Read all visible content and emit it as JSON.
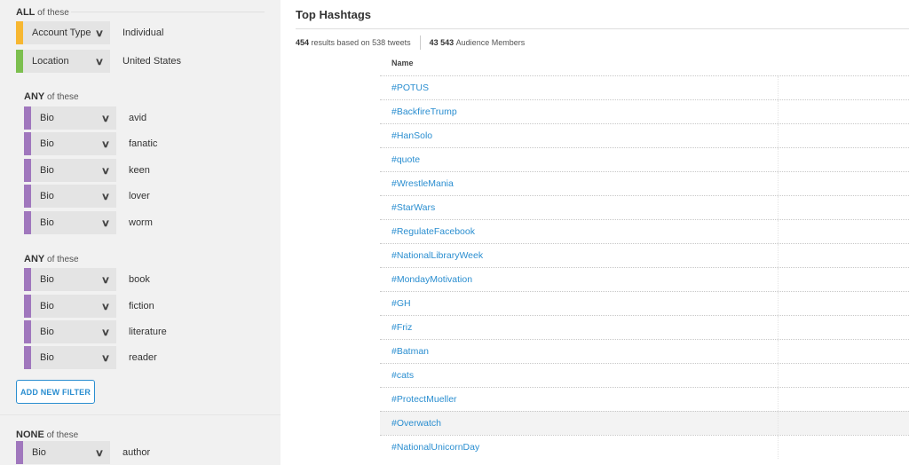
{
  "colors": {
    "yellow": "#f7b731",
    "green": "#7cbf4f",
    "purple": "#a077bd",
    "link": "#2a8ed0"
  },
  "sidebar": {
    "all_group": {
      "label_strong": "ALL",
      "label_rest": "of these",
      "filters": [
        {
          "field": "Account Type",
          "value": "Individual",
          "color": "yellow"
        },
        {
          "field": "Location",
          "value": "United States",
          "color": "green"
        }
      ]
    },
    "any_group_1": {
      "label_strong": "ANY",
      "label_rest": "of these",
      "filters": [
        {
          "field": "Bio",
          "value": "avid"
        },
        {
          "field": "Bio",
          "value": "fanatic"
        },
        {
          "field": "Bio",
          "value": "keen"
        },
        {
          "field": "Bio",
          "value": "lover"
        },
        {
          "field": "Bio",
          "value": "worm"
        }
      ]
    },
    "any_group_2": {
      "label_strong": "ANY",
      "label_rest": "of these",
      "filters": [
        {
          "field": "Bio",
          "value": "book"
        },
        {
          "field": "Bio",
          "value": "fiction"
        },
        {
          "field": "Bio",
          "value": "literature"
        },
        {
          "field": "Bio",
          "value": "reader"
        }
      ]
    },
    "add_filter_label": "ADD NEW FILTER",
    "none_group": {
      "label_strong": "NONE",
      "label_rest": "of these",
      "filters": [
        {
          "field": "Bio",
          "value": "author"
        }
      ]
    },
    "chevron_icon": "chevron-down-icon"
  },
  "main": {
    "title": "Top Hashtags",
    "results_count": "454",
    "results_text": "results based on 538 tweets",
    "audience_count": "43 543",
    "audience_text": "Audience Members",
    "column_header": "Name",
    "highlighted_row": "#Overwatch",
    "hashtags": [
      "#POTUS",
      "#BackfireTrump",
      "#HanSolo",
      "#quote",
      "#WrestleMania",
      "#StarWars",
      "#RegulateFacebook",
      "#NationalLibraryWeek",
      "#MondayMotivation",
      "#GH",
      "#Friz",
      "#Batman",
      "#cats",
      "#ProtectMueller",
      "#Overwatch",
      "#NationalUnicornDay"
    ]
  }
}
